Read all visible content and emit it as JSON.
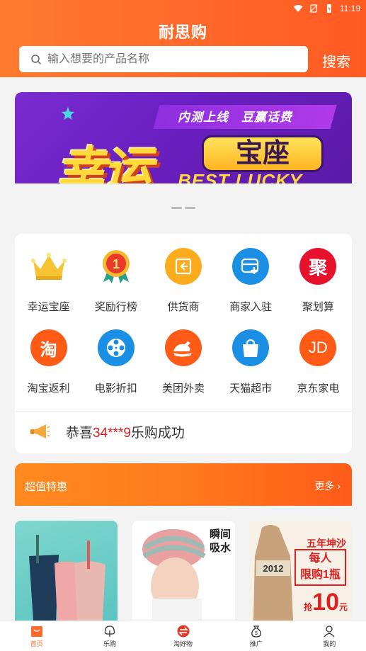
{
  "status_bar": {
    "time": "11:19"
  },
  "header": {
    "title": "耐思购",
    "search_placeholder": "输入想要的产品名称",
    "search_button": "搜索"
  },
  "banner": {
    "subtitle": "内测上线　豆赢话费",
    "main_text": "幸运",
    "pill_text": "宝座",
    "english_text": "BEST LUCKY"
  },
  "categories": [
    {
      "label": "幸运宝座",
      "icon": "crown-icon"
    },
    {
      "label": "奖励行榜",
      "icon": "medal-icon",
      "glyph": "1"
    },
    {
      "label": "供货商",
      "icon": "supplier-icon"
    },
    {
      "label": "商家入驻",
      "icon": "merchant-join-icon"
    },
    {
      "label": "聚划算",
      "icon": "juhuasuan-icon",
      "glyph": "聚"
    },
    {
      "label": "淘宝返利",
      "icon": "taobao-icon",
      "glyph": "淘"
    },
    {
      "label": "电影折扣",
      "icon": "film-reel-icon"
    },
    {
      "label": "美团外卖",
      "icon": "meituan-icon"
    },
    {
      "label": "天猫超市",
      "icon": "tmall-bag-icon"
    },
    {
      "label": "京东家电",
      "icon": "jd-icon",
      "glyph": "JD"
    }
  ],
  "notice": {
    "prefix": "恭喜",
    "highlight": "34***9",
    "suffix": "乐购成功"
  },
  "deals": {
    "title": "超值特惠",
    "more": "更多"
  },
  "products": [
    {
      "name": "toothbrush-cups"
    },
    {
      "tag_line1": "瞬间",
      "tag_line2": "吸水"
    },
    {
      "title": "五年坤沙",
      "box_line1": "每人",
      "box_line2": "限购1瓶",
      "price_prefix": "抢",
      "price": "10",
      "price_unit": "元",
      "bag_text": "2012"
    }
  ],
  "tabbar": [
    {
      "label": "首页",
      "icon": "home-bag-icon",
      "active": true
    },
    {
      "label": "乐购",
      "icon": "tree-icon",
      "active": false
    },
    {
      "label": "淘好物",
      "icon": "exchange-icon",
      "active": false
    },
    {
      "label": "推广",
      "icon": "money-bag-icon",
      "active": false
    },
    {
      "label": "我的",
      "icon": "user-icon",
      "active": false
    }
  ],
  "colors": {
    "accent": "#ff6a2a",
    "highlight": "#e02020"
  }
}
